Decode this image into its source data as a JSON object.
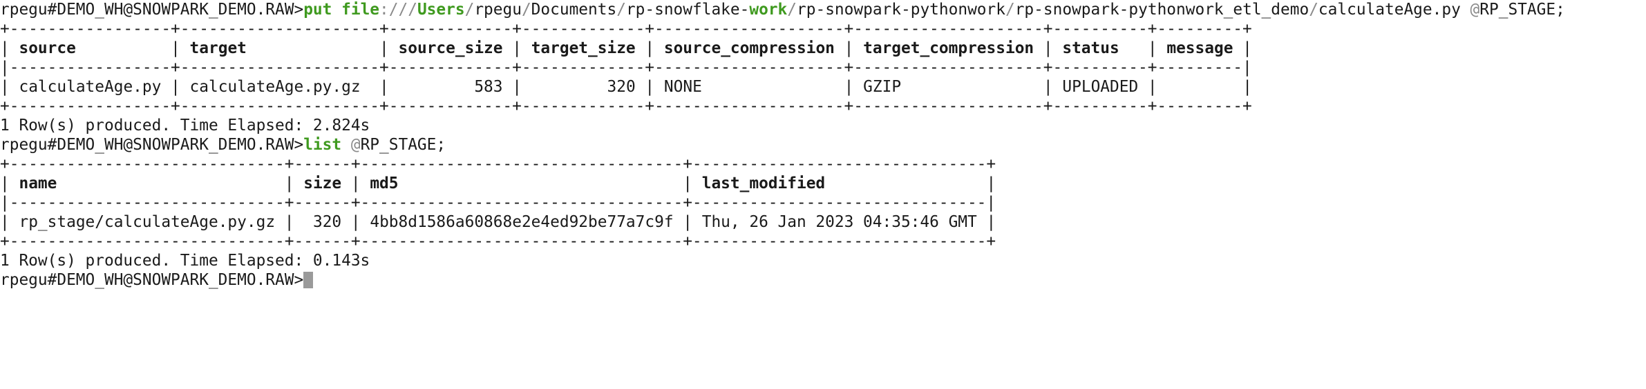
{
  "prompt": "rpegu#DEMO_WH@SNOWPARK_DEMO.RAW>",
  "command1": {
    "kw_put": "put",
    "kw_file": "file",
    "scheme_sep": "://",
    "path_slash1": "/",
    "path_users": "Users",
    "path_slash2": "/",
    "path_user": "rpegu",
    "path_slash3": "/",
    "path_docs": "Documents",
    "path_slash4": "/",
    "path_rp_snowflake": "rp-snowflake-",
    "path_work": "work",
    "path_slash5": "/",
    "path_pythonwork": "rp-snowpark-pythonwork",
    "path_slash6": "/",
    "path_etl": "rp-snowpark-pythonwork_etl_demo",
    "path_slash7": "/",
    "path_file": "calculateAge.py",
    "at": "@",
    "stage": "RP_STAGE;"
  },
  "table1": {
    "border": "+-----------------+---------------------+-------------+-------------+--------------------+--------------------+----------+---------+",
    "header_sep": "|-----------------+---------------------+-------------+-------------+--------------------+--------------------+----------+---------|",
    "headers": [
      "source",
      "target",
      "source_size",
      "target_size",
      "source_compression",
      "target_compression",
      "status",
      "message"
    ],
    "widths": [
      15,
      19,
      11,
      11,
      18,
      18,
      8,
      7
    ],
    "align": [
      "l",
      "l",
      "r",
      "r",
      "l",
      "l",
      "l",
      "l"
    ],
    "rows": [
      [
        "calculateAge.py",
        "calculateAge.py.gz",
        "583",
        "320",
        "NONE",
        "GZIP",
        "UPLOADED",
        ""
      ]
    ]
  },
  "result1": "1 Row(s) produced. Time Elapsed: 2.824s",
  "command2": {
    "kw_list": "list",
    "at": "@",
    "stage": "RP_STAGE;"
  },
  "table2": {
    "border": "+-----------------------------+------+----------------------------------+-------------------------------+",
    "header_sep": "|-----------------------------+------+----------------------------------+-------------------------------|",
    "headers": [
      "name",
      "size",
      "md5",
      "last_modified"
    ],
    "widths": [
      27,
      4,
      32,
      29
    ],
    "align": [
      "l",
      "r",
      "l",
      "l"
    ],
    "rows": [
      [
        "rp_stage/calculateAge.py.gz",
        "320",
        "4bb8d1586a60868e2e4ed92be77a7c9f",
        "Thu, 26 Jan 2023 04:35:46 GMT"
      ]
    ]
  },
  "result2": "1 Row(s) produced. Time Elapsed: 0.143s",
  "prompt_final": "rpegu#DEMO_WH@SNOWPARK_DEMO.RAW>"
}
